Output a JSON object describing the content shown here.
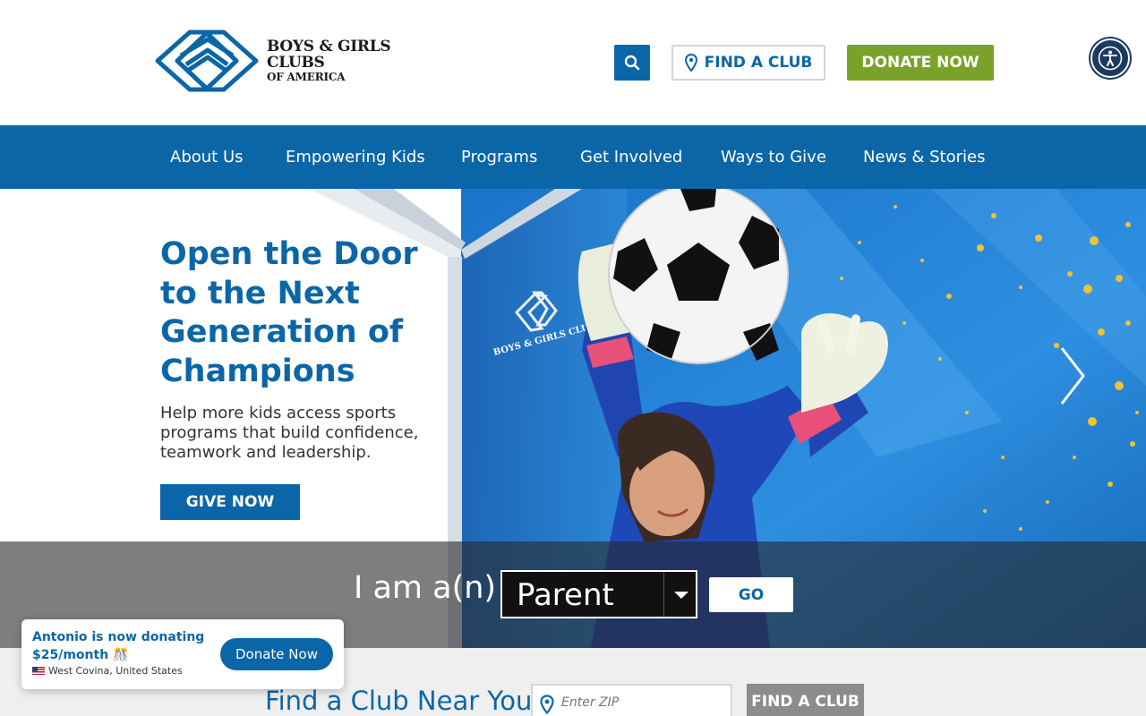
{
  "header": {
    "logo_line1": "BOYS & GIRLS CLUBS",
    "logo_line2": "OF AMERICA",
    "search_icon": "search-icon",
    "find_club_label": "FIND A CLUB",
    "donate_label": "DONATE NOW",
    "accessibility_icon": "accessibility-icon"
  },
  "nav": {
    "items": [
      {
        "label": "About Us"
      },
      {
        "label": "Empowering Kids"
      },
      {
        "label": "Programs"
      },
      {
        "label": "Get Involved"
      },
      {
        "label": "Ways to Give"
      },
      {
        "label": "News & Stories"
      }
    ]
  },
  "hero": {
    "title": "Open the Door to the Next Generation of Champions",
    "subtitle": "Help more kids access sports programs that build confidence, teamwork and leadership.",
    "cta_label": "GIVE NOW",
    "image_logo_text": "BOYS & GIRLS CLUBS"
  },
  "iam": {
    "label": "I am a(n)",
    "selected": "Parent",
    "go_label": "GO"
  },
  "find_section": {
    "title": "Find a Club Near You",
    "zip_placeholder": "Enter ZIP",
    "button_label": "FIND A CLUB"
  },
  "toast": {
    "message": "Antonio is now donating $25/month 🎊",
    "location": "West Covina, United States",
    "button_label": "Donate Now"
  },
  "colors": {
    "brand_blue": "#0b66a7",
    "donate_green": "#7ba228",
    "accessibility_navy": "#1b3a5f"
  }
}
